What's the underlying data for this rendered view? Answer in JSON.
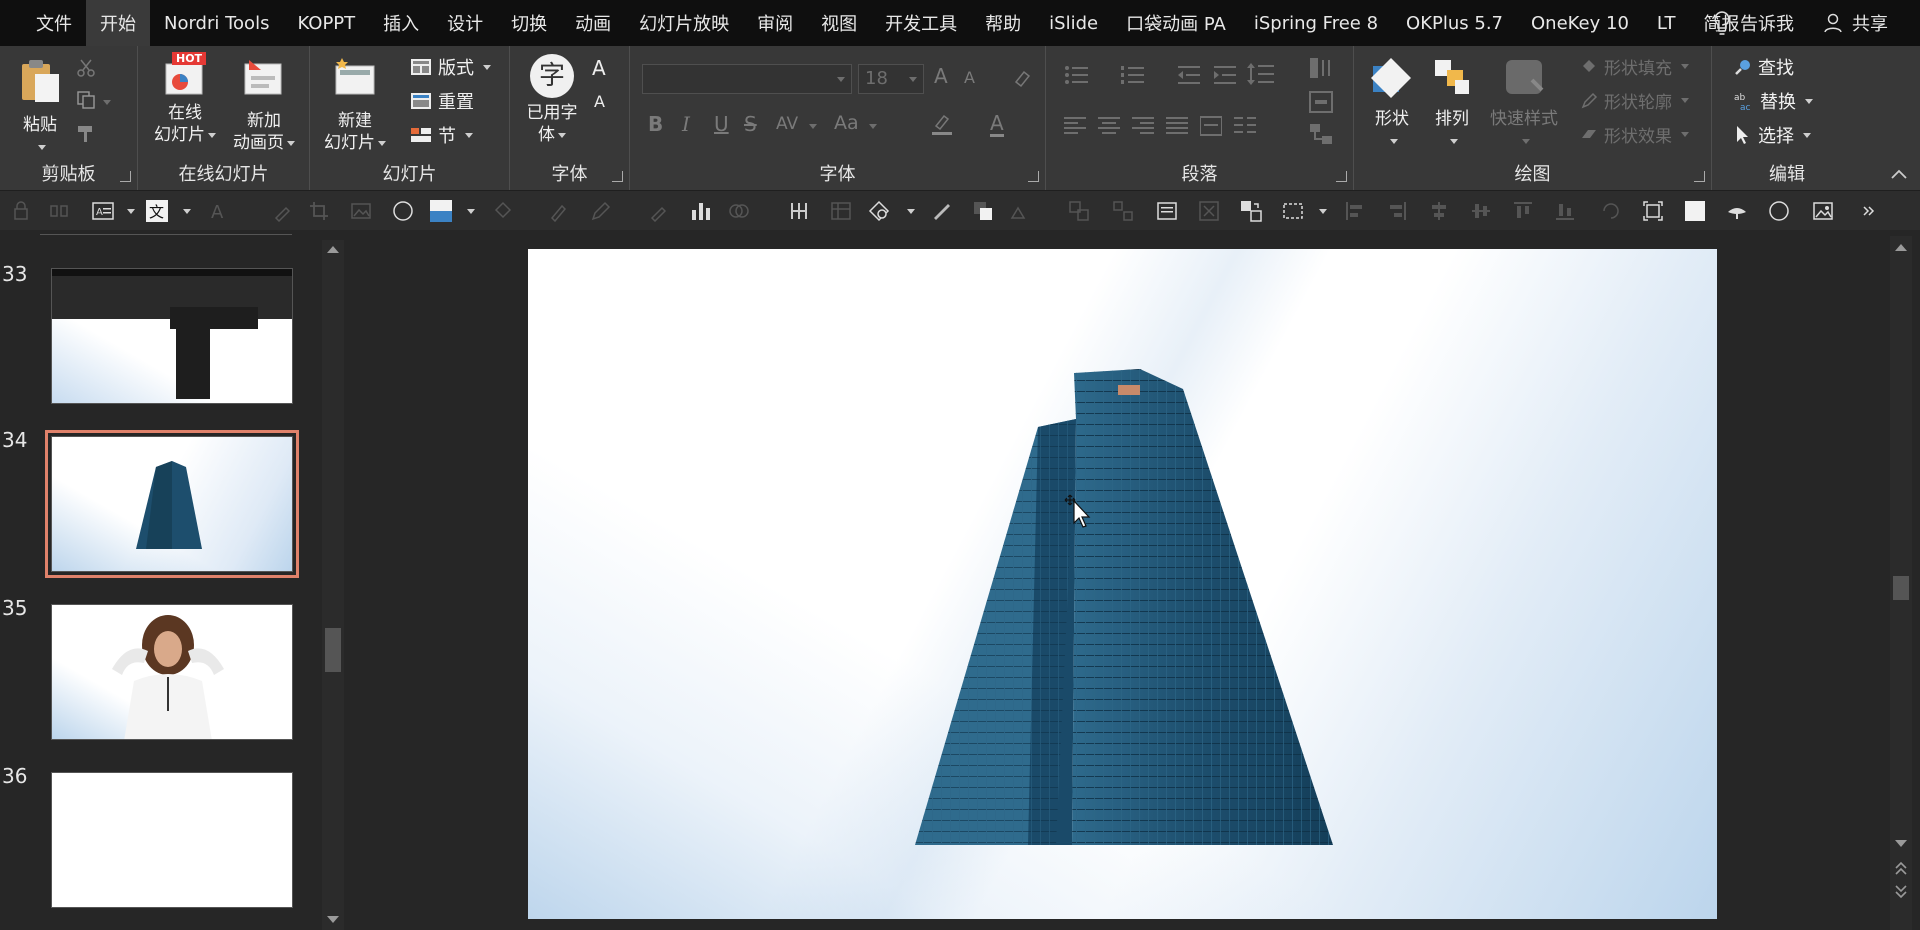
{
  "menu": {
    "tabs": [
      "文件",
      "开始",
      "Nordri Tools",
      "KOPPT",
      "插入",
      "设计",
      "切换",
      "动画",
      "幻灯片放映",
      "审阅",
      "视图",
      "开发工具",
      "帮助",
      "iSlide",
      "口袋动画 PA",
      "iSpring Free 8",
      "OKPlus 5.7",
      "OneKey 10",
      "LT",
      "简报"
    ],
    "active_index": 1,
    "tell_me": "告诉我",
    "share": "共享"
  },
  "ribbon": {
    "clipboard": {
      "label": "剪贴板",
      "paste": "粘贴"
    },
    "online_slides": {
      "label": "在线幻灯片",
      "online_l1": "在线",
      "online_l2": "幻灯片",
      "new_anim_l1": "新加",
      "new_anim_l2": "动画页",
      "hot_badge": "HOT"
    },
    "slides": {
      "label": "幻灯片",
      "new_l1": "新建",
      "new_l2": "幻灯片",
      "layout": "版式",
      "reset": "重置",
      "section": "节"
    },
    "font_used": {
      "label": "字体",
      "btn_l1": "已用字",
      "btn_l2": "体",
      "glyph": "字"
    },
    "font": {
      "label": "字体",
      "size": "18",
      "font_name": "",
      "bold": "B",
      "italic": "I",
      "underline": "U",
      "strike": "S",
      "spacing": "AV",
      "case": "Aa",
      "grow": "A",
      "shrink": "A"
    },
    "paragraph": {
      "label": "段落"
    },
    "drawing": {
      "label": "绘图",
      "shapes": "形状",
      "arrange": "排列",
      "quick_styles": "快速样式",
      "fill": "形状填充",
      "outline": "形状轮廓",
      "effects": "形状效果"
    },
    "editing": {
      "label": "编辑",
      "find": "查找",
      "replace": "替换",
      "select": "选择"
    }
  },
  "thumbnails": [
    {
      "number": "33",
      "kind": "ribbon-screenshot"
    },
    {
      "number": "34",
      "kind": "building",
      "selected": true
    },
    {
      "number": "35",
      "kind": "woman"
    },
    {
      "number": "36",
      "kind": "blank"
    }
  ],
  "colors": {
    "selection_outline": "#e0826b",
    "building": "#1d4e6d",
    "menubar_bg": "#0f0f0f",
    "ribbon_bg": "#383838"
  }
}
